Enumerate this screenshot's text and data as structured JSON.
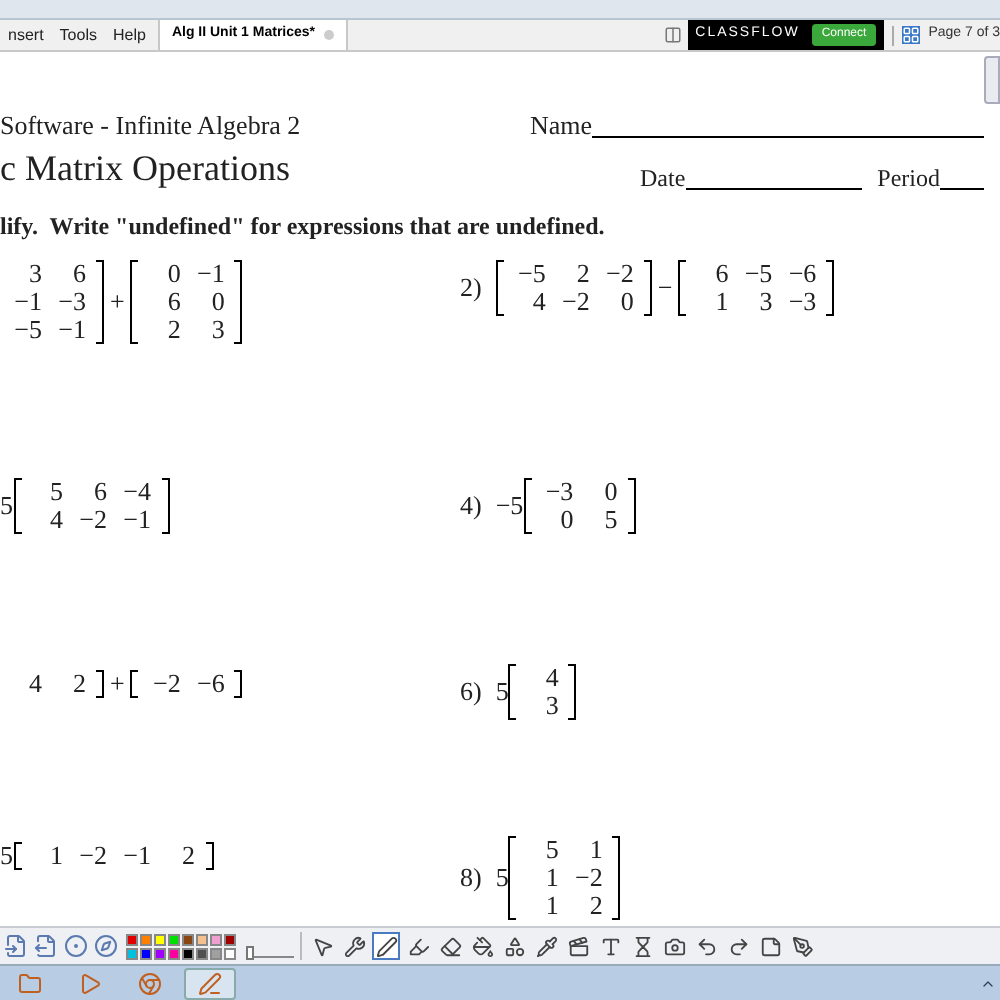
{
  "menu": [
    {
      "label": "nsert"
    },
    {
      "label": "Tools"
    },
    {
      "label": "Help"
    }
  ],
  "document_tab": {
    "label": "Alg II Unit 1 Matrices*",
    "selected": true
  },
  "classflow": {
    "brand": "CLASSFLOW",
    "button": "Connect"
  },
  "page_indicator": "Page 7 of 3",
  "worksheet": {
    "publisher": "Software - Infinite Algebra 2",
    "name_label": "Name",
    "title": "c Matrix Operations",
    "date_label": "Date",
    "period_label": "Period",
    "instructions": "lify.  Write \"undefined\" for expressions that are undefined.",
    "problems": [
      {
        "terms": [
          {
            "kind": "matrix",
            "cut_left": true,
            "rows": [
              [
                "3",
                "6"
              ],
              [
                "−1",
                "−3"
              ],
              [
                "−5",
                "−1"
              ]
            ]
          },
          {
            "kind": "operator",
            "text": "+"
          },
          {
            "kind": "matrix",
            "cut_left": false,
            "rows": [
              [
                "0",
                "−1"
              ],
              [
                "6",
                "0"
              ],
              [
                "2",
                "3"
              ]
            ]
          }
        ]
      },
      {
        "number": "2)",
        "terms": [
          {
            "kind": "matrix",
            "cut_left": false,
            "rows": [
              [
                "−5",
                "2",
                "−2"
              ],
              [
                "4",
                "−2",
                "0"
              ]
            ]
          },
          {
            "kind": "operator",
            "text": "−"
          },
          {
            "kind": "matrix",
            "cut_left": false,
            "rows": [
              [
                "6",
                "−5",
                "−6"
              ],
              [
                "1",
                "3",
                "−3"
              ]
            ]
          }
        ]
      },
      {
        "terms": [
          {
            "kind": "scalar",
            "text": "5"
          },
          {
            "kind": "matrix",
            "cut_left": false,
            "rows": [
              [
                "5",
                "6",
                "−4"
              ],
              [
                "4",
                "−2",
                "−1"
              ]
            ]
          }
        ]
      },
      {
        "number": "4)",
        "terms": [
          {
            "kind": "scalar",
            "text": "−5"
          },
          {
            "kind": "matrix",
            "cut_left": false,
            "rows": [
              [
                "−3",
                "0"
              ],
              [
                "0",
                "5"
              ]
            ]
          }
        ]
      },
      {
        "terms": [
          {
            "kind": "matrix",
            "cut_left": true,
            "rows": [
              [
                "4",
                "2"
              ]
            ]
          },
          {
            "kind": "operator",
            "text": "+"
          },
          {
            "kind": "matrix",
            "cut_left": false,
            "rows": [
              [
                "−2",
                "−6"
              ]
            ]
          }
        ]
      },
      {
        "number": "6)",
        "terms": [
          {
            "kind": "scalar",
            "text": "5"
          },
          {
            "kind": "matrix",
            "cut_left": false,
            "rows": [
              [
                "4"
              ],
              [
                "3"
              ]
            ]
          }
        ]
      },
      {
        "terms": [
          {
            "kind": "scalar",
            "text": "5"
          },
          {
            "kind": "matrix",
            "cut_left": false,
            "rows": [
              [
                "1",
                "−2",
                "−1",
                "2"
              ]
            ]
          }
        ]
      },
      {
        "number": "8)",
        "terms": [
          {
            "kind": "scalar",
            "text": "5"
          },
          {
            "kind": "matrix",
            "cut_left": false,
            "rows": [
              [
                "5",
                "1"
              ],
              [
                "1",
                "−2"
              ],
              [
                "1",
                "2"
              ]
            ]
          }
        ]
      }
    ]
  },
  "colors": [
    {
      "color": "#e00000"
    },
    {
      "color": "#ff8000"
    },
    {
      "color": "#ffff00"
    },
    {
      "color": "#00e000"
    },
    {
      "color": "#8b4513"
    },
    {
      "color": "#f5c090"
    },
    {
      "color": "#f0a0d0"
    },
    {
      "color": "#a00000"
    },
    {
      "color": "#00c0e0"
    },
    {
      "color": "#0000ff"
    },
    {
      "color": "#a000ff"
    },
    {
      "color": "#ff00a0"
    },
    {
      "color": "#000000"
    },
    {
      "color": "#505050"
    },
    {
      "color": "#a0a0a0"
    },
    {
      "color": "#ffffff"
    }
  ],
  "pen_width": {
    "level": 0
  },
  "tools": [
    {
      "selected": false
    },
    {
      "selected": false
    },
    {
      "selected": true
    },
    {
      "selected": false
    },
    {
      "selected": false
    },
    {
      "selected": false
    },
    {
      "selected": false
    },
    {
      "selected": false
    },
    {
      "selected": false
    },
    {
      "selected": false
    },
    {
      "selected": false
    },
    {
      "selected": false
    },
    {
      "selected": false
    },
    {
      "selected": false
    },
    {
      "selected": false
    },
    {
      "selected": false
    }
  ],
  "taskbar": [
    {
      "selected": false
    },
    {
      "selected": false
    },
    {
      "selected": false
    },
    {
      "selected": true
    }
  ]
}
